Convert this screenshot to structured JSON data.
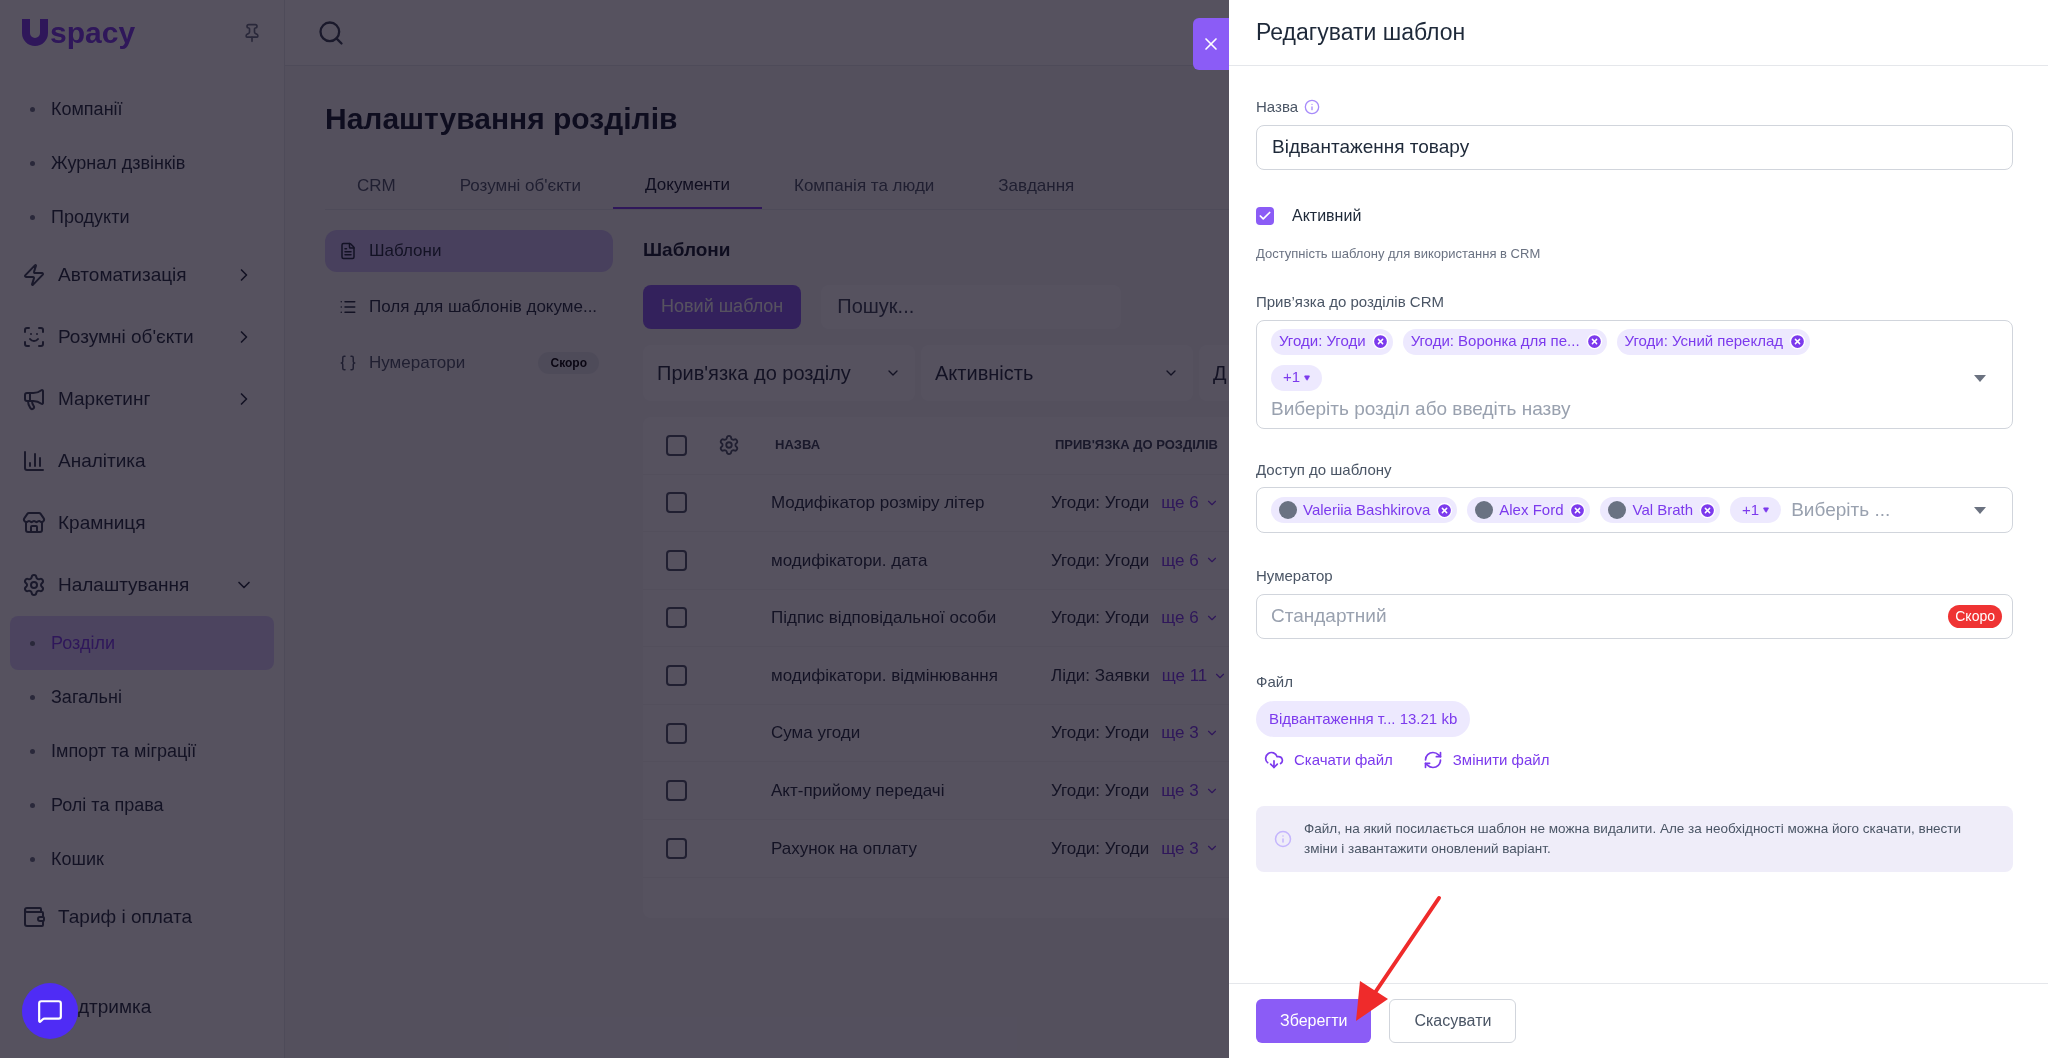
{
  "sidebar": {
    "logo": "spacy",
    "items": [
      {
        "kind": "subitem",
        "label": "Компанії",
        "selected": false
      },
      {
        "kind": "subitem",
        "label": "Журнал дзвінків",
        "selected": false
      },
      {
        "kind": "subitem",
        "label": "Продукти",
        "selected": false
      },
      {
        "kind": "section",
        "label": "Автоматизація",
        "expanded": false
      },
      {
        "kind": "section",
        "label": "Розумні об'єкти",
        "expanded": false
      },
      {
        "kind": "section",
        "label": "Маркетинг",
        "expanded": false
      },
      {
        "kind": "section",
        "label": "Аналітика"
      },
      {
        "kind": "section",
        "label": "Крамниця"
      },
      {
        "kind": "section",
        "label": "Налаштування",
        "expanded": true,
        "children": [
          {
            "kind": "subitem",
            "label": "Розділи",
            "selected": true
          },
          {
            "kind": "subitem",
            "label": "Загальні",
            "selected": false
          },
          {
            "kind": "subitem",
            "label": "Імпорт та міграції",
            "selected": false
          },
          {
            "kind": "subitem",
            "label": "Ролі та права",
            "selected": false
          },
          {
            "kind": "subitem",
            "label": "Кошик",
            "selected": false
          }
        ]
      },
      {
        "kind": "section",
        "label": "Тариф і оплата"
      },
      {
        "kind": "section",
        "label": "дтримка"
      }
    ]
  },
  "page": {
    "title": "Налаштування розділів",
    "tabs": [
      {
        "label": "CRM",
        "selected": false
      },
      {
        "label": "Розумні об'єкти",
        "selected": false
      },
      {
        "label": "Документи",
        "selected": true
      },
      {
        "label": "Компанія та люди",
        "selected": false
      },
      {
        "label": "Завдання",
        "selected": false
      }
    ],
    "subnav": [
      {
        "label": "Шаблони",
        "selected": true,
        "disabled": false
      },
      {
        "label": "Поля для шаблонів докуме...",
        "selected": false,
        "disabled": false
      },
      {
        "label": "Нумератори",
        "selected": false,
        "disabled": true,
        "badge": "Скоро"
      }
    ],
    "section_title": "Шаблони",
    "new_button": "Новий шаблон",
    "search": {
      "placeholder": "Пошук..."
    },
    "filters": [
      "Прив'язка до розділу",
      "Активність",
      "Д"
    ],
    "table": {
      "all_checked": false,
      "columns": [
        "НАЗВА",
        "ПРИВ'ЯЗКА ДО РОЗДІЛІВ"
      ],
      "rows": [
        {
          "name": "Модифікатор розміру літер",
          "binding": "Угоди: Угоди",
          "more": "ще 6",
          "checked": false
        },
        {
          "name": "модифікатори. дата",
          "binding": "Угоди: Угоди",
          "more": "ще 6",
          "checked": false
        },
        {
          "name": "Підпис відповідальної особи",
          "binding": "Угоди: Угоди",
          "more": "ще 6",
          "checked": false
        },
        {
          "name": "модифікатори. відмінювання",
          "binding": "Ліди: Заявки",
          "more": "ще 11",
          "checked": false
        },
        {
          "name": "Сума угоди",
          "binding": "Угоди: Угоди",
          "more": "ще 3",
          "checked": false
        },
        {
          "name": "Акт-прийому передачі",
          "binding": "Угоди: Угоди",
          "more": "ще 3",
          "checked": false
        },
        {
          "name": "Рахунок на оплату",
          "binding": "Угоди: Угоди",
          "more": "ще 3",
          "checked": false
        }
      ]
    }
  },
  "panel": {
    "title": "Редагувати шаблон",
    "name": {
      "label": "Назва",
      "value": "Відвантаження товару"
    },
    "active": {
      "label": "Активний",
      "checked": true,
      "hint": "Доступність шаблону для використання в CRM"
    },
    "crm": {
      "label": "Прив’язка до розділів CRM",
      "chips": [
        "Угоди: Угоди",
        "Угоди: Воронка для пе...",
        "Угоди: Усний переклад"
      ],
      "more": "+1",
      "placeholder": "Виберіть розділ або введіть назву"
    },
    "access": {
      "label": "Доступ до шаблону",
      "chips": [
        "Valeriia Bashkirova",
        "Alex Ford",
        "Val Brath"
      ],
      "more": "+1",
      "placeholder": "Виберіть ..."
    },
    "numerator": {
      "label": "Нумератор",
      "placeholder": "Стандартний",
      "badge": "Скоро"
    },
    "file": {
      "label": "Файл",
      "chip": "Відвантаження т... 13.21 kb",
      "download": "Скачати файл",
      "replace": "Змінити файл"
    },
    "note": "Файл, на який посилається шаблон не можна видалити. Але за необхідності можна його скачати, внести зміни і завантажити оновлений варіант.",
    "buttons": {
      "save": "Зберегти",
      "cancel": "Скасувати"
    }
  }
}
